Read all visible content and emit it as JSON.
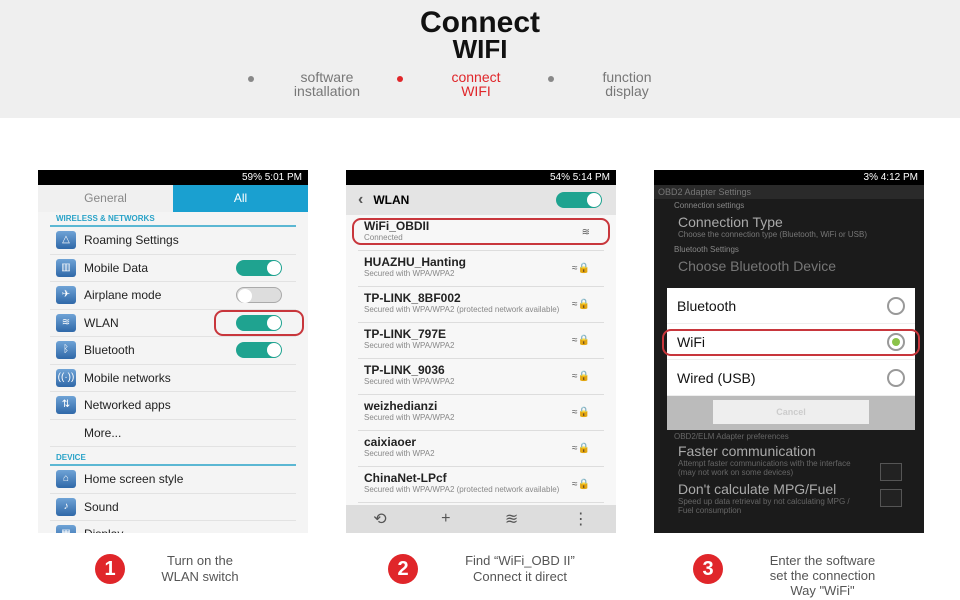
{
  "header": {
    "title1": "Connect",
    "title2": "WIFI",
    "steps": [
      {
        "l1": "software",
        "l2": "installation"
      },
      {
        "l1": "connect",
        "l2": "WIFI"
      },
      {
        "l1": "function",
        "l2": "display"
      }
    ],
    "accent": "#e0262a"
  },
  "phone1": {
    "status": "59%  5:01 PM",
    "tabs": [
      "General",
      "All"
    ],
    "section1": "WIRELESS & NETWORKS",
    "items": [
      {
        "label": "Roaming Settings",
        "icon": "roaming-icon"
      },
      {
        "label": "Mobile Data",
        "icon": "mobile-data-icon",
        "toggle": true
      },
      {
        "label": "Airplane mode",
        "icon": "airplane-icon",
        "toggle": false
      },
      {
        "label": "WLAN",
        "icon": "wifi-icon",
        "toggle": true
      },
      {
        "label": "Bluetooth",
        "icon": "bluetooth-icon",
        "toggle": true
      },
      {
        "label": "Mobile networks",
        "icon": "antenna-icon"
      },
      {
        "label": "Networked apps",
        "icon": "networked-apps-icon"
      },
      {
        "label": "More...",
        "icon": ""
      }
    ],
    "section2": "DEVICE",
    "items2": [
      {
        "label": "Home screen style",
        "icon": "home-icon"
      },
      {
        "label": "Sound",
        "icon": "sound-icon"
      },
      {
        "label": "Display",
        "icon": "display-icon"
      }
    ]
  },
  "phone2": {
    "status": "54%  5:14 PM",
    "title": "WLAN",
    "networks": [
      {
        "name": "WiFi_OBDII",
        "sub": "Connected"
      },
      {
        "name": "HUAZHU_Hanting",
        "sub": "Secured with WPA/WPA2"
      },
      {
        "name": "TP-LINK_8BF002",
        "sub": "Secured with WPA/WPA2 (protected network available)"
      },
      {
        "name": "TP-LINK_797E",
        "sub": "Secured with WPA/WPA2"
      },
      {
        "name": "TP-LINK_9036",
        "sub": "Secured with WPA/WPA2"
      },
      {
        "name": "weizhedianzi",
        "sub": "Secured with WPA/WPA2"
      },
      {
        "name": "caixiaoer",
        "sub": "Secured with WPA2"
      },
      {
        "name": "ChinaNet-LPcf",
        "sub": "Secured with WPA/WPA2 (protected network available)"
      }
    ]
  },
  "phone3": {
    "status": "3%  4:12 PM",
    "appbar": "OBD2 Adapter Settings",
    "conn_settings": "Connection settings",
    "conn_type": "Connection Type",
    "conn_type_desc": "Choose the connection type (Bluetooth, WiFi or USB)",
    "bt_settings": "Bluetooth Settings",
    "choose_bt": "Choose Bluetooth Device",
    "options": [
      {
        "label": "Bluetooth",
        "selected": false
      },
      {
        "label": "WiFi",
        "selected": true
      },
      {
        "label": "Wired (USB)",
        "selected": false
      }
    ],
    "cancel": "Cancel",
    "elm_prefs": "OBD2/ELM Adapter preferences",
    "faster": "Faster communication",
    "faster_desc": "Attempt faster communications with the interface (may not work on some devices)",
    "mpg": "Don't calculate MPG/Fuel",
    "mpg_desc": "Speed up data retrieval by not calculating MPG / Fuel consumption"
  },
  "captions": [
    {
      "num": "1",
      "l1": "Turn on the",
      "l2": "WLAN switch"
    },
    {
      "num": "2",
      "l1": "Find  “WiFi_OBD II”",
      "l2": "Connect it direct"
    },
    {
      "num": "3",
      "l1": "Enter the software",
      "l2": "set the connection",
      "l3": "Way \"WiFi\""
    }
  ]
}
